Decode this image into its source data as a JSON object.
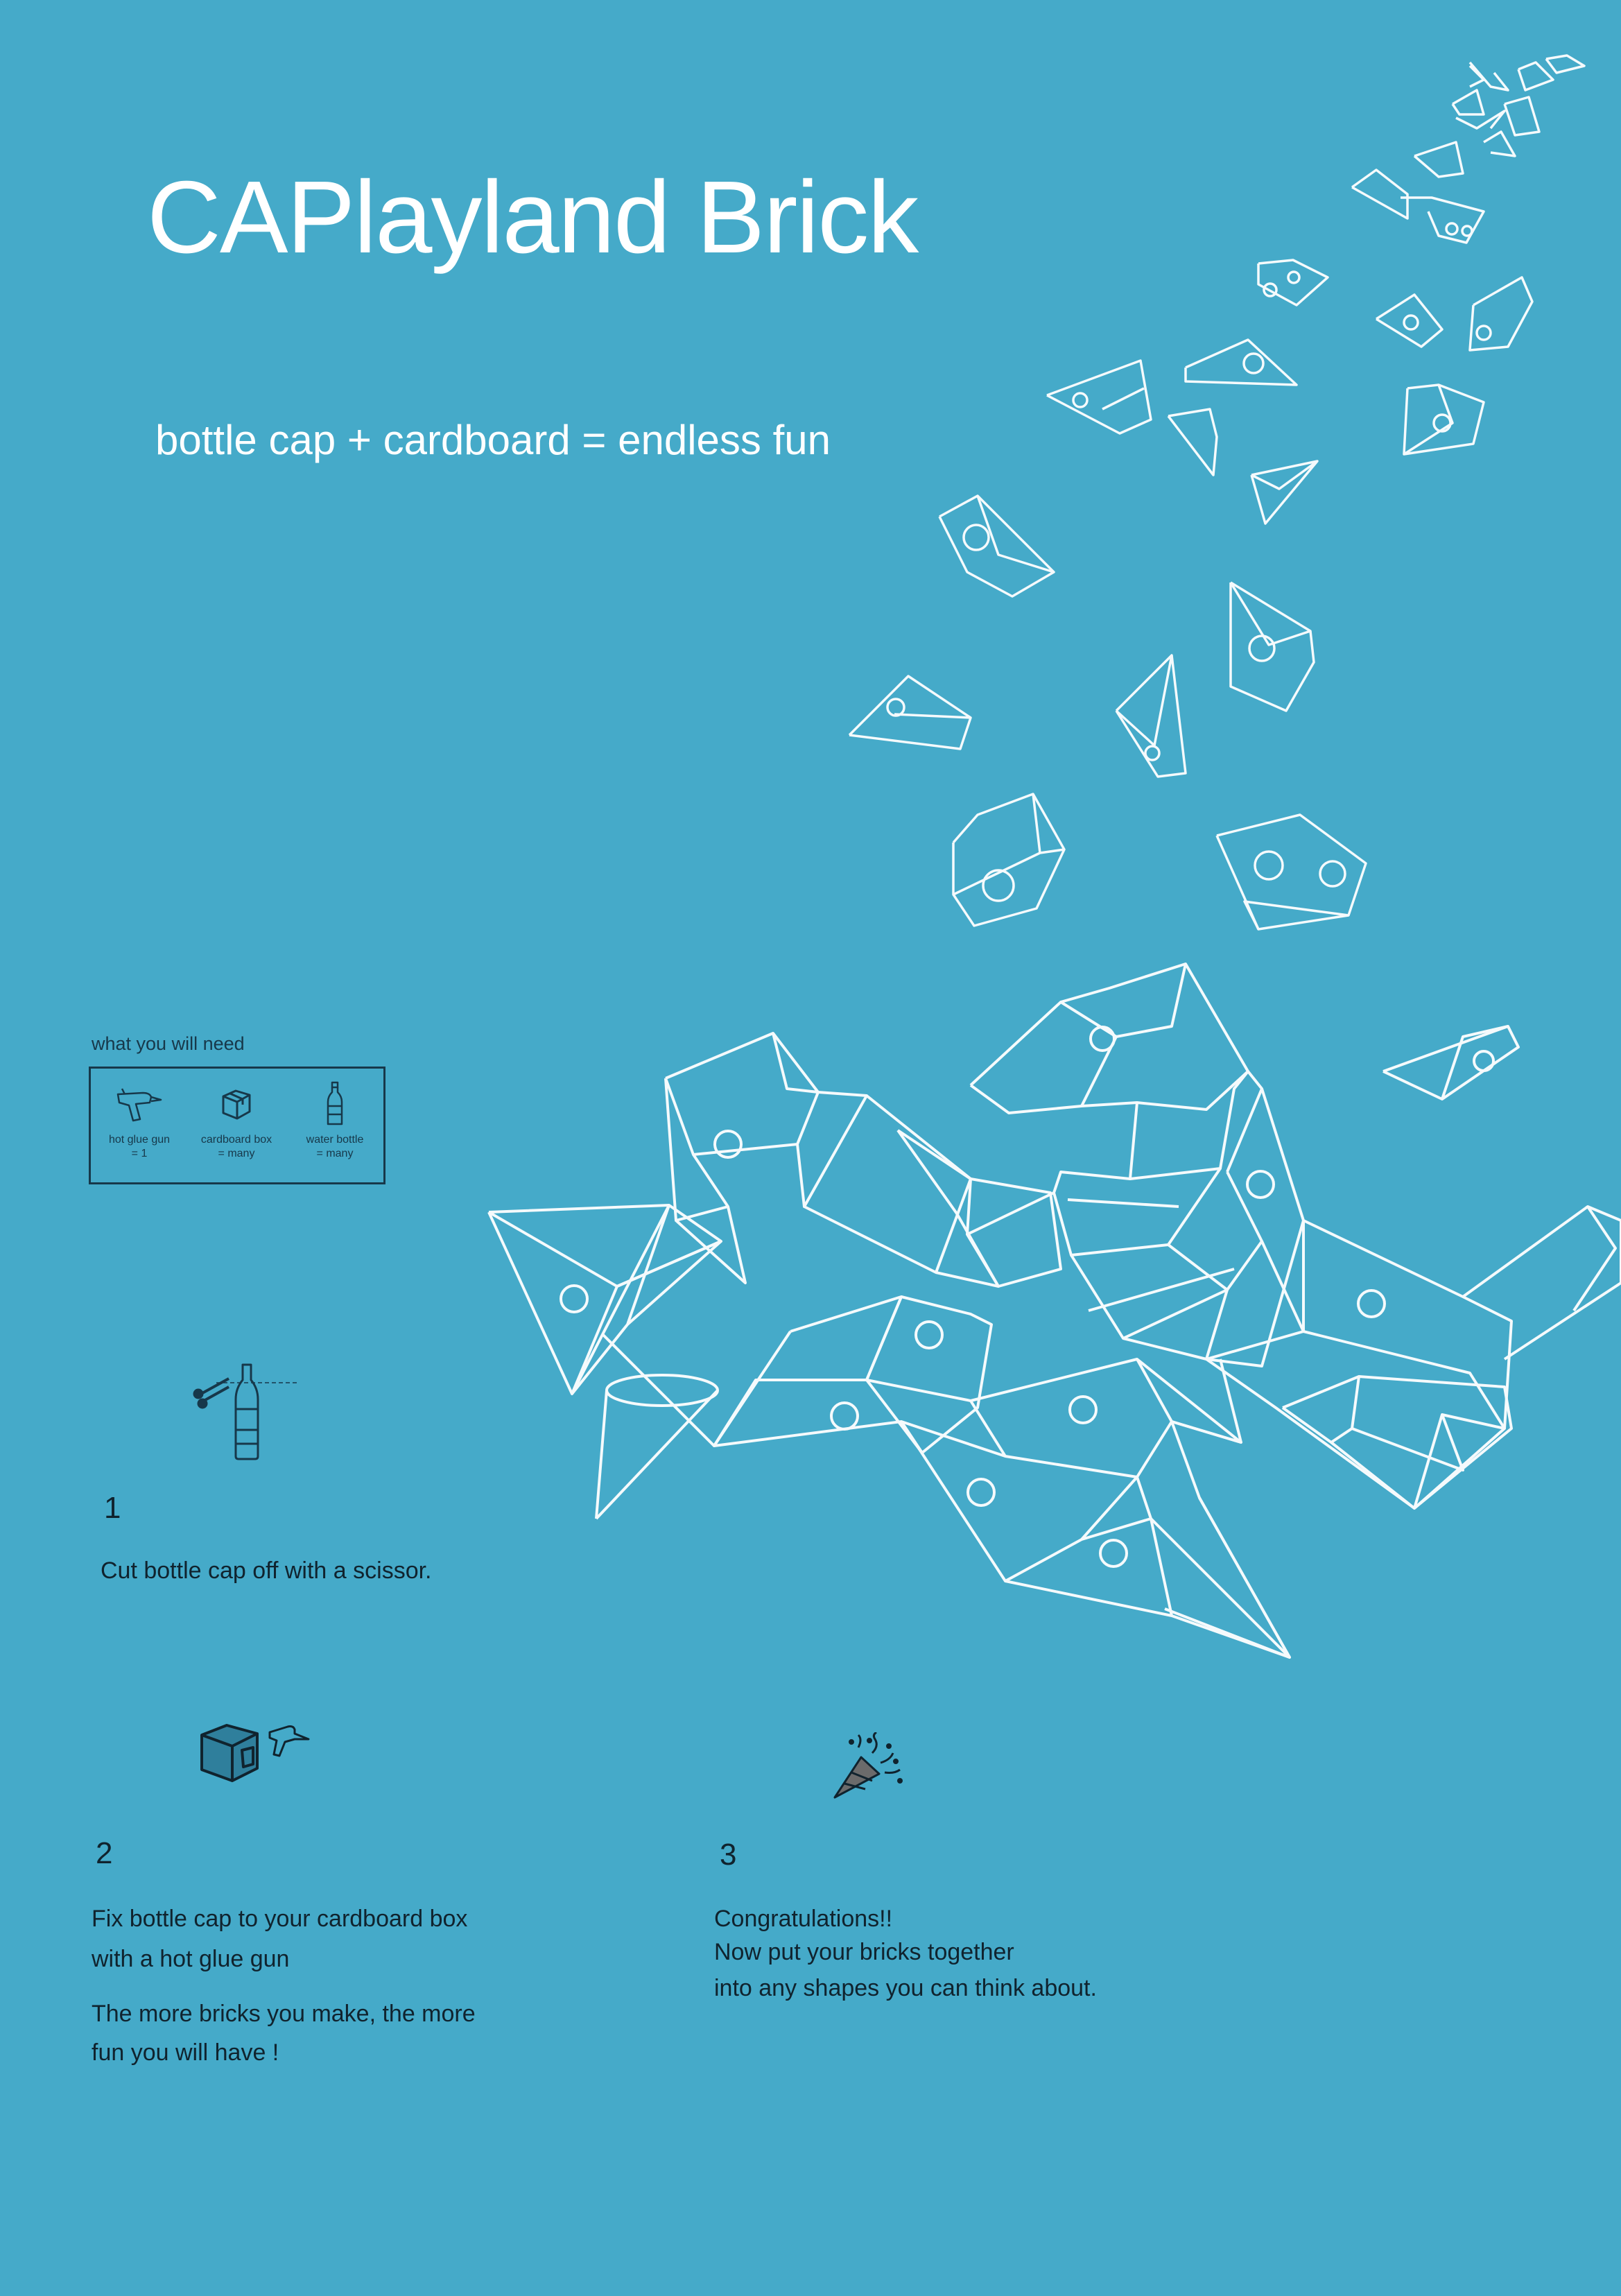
{
  "poster": {
    "title": "CAPlayland Brick",
    "subtitle": "bottle cap + cardboard = endless fun",
    "background_color": "#45aac9",
    "line_color": "#ffffff",
    "ink_color": "#17384a"
  },
  "materials": {
    "label": "what you will need",
    "items": [
      {
        "icon": "hot-glue-gun-icon",
        "name": "hot glue gun",
        "qty": "=  1"
      },
      {
        "icon": "cardboard-box-icon",
        "name": "cardboard box",
        "qty": "=  many"
      },
      {
        "icon": "water-bottle-icon",
        "name": "water bottle",
        "qty": "=  many"
      }
    ]
  },
  "steps": [
    {
      "number": "1",
      "icon": "scissors-bottle-icon",
      "lines": [
        "Cut bottle cap off with a scissor."
      ]
    },
    {
      "number": "2",
      "icon": "box-glue-gun-icon",
      "lines": [
        "Fix bottle cap to your cardboard box",
        "with a hot glue gun",
        "The more bricks you make, the more",
        "fun you will have !"
      ]
    },
    {
      "number": "3",
      "icon": "party-popper-icon",
      "lines": [
        "Congratulations!!",
        "Now put your bricks together",
        "into any shapes you can think about."
      ]
    }
  ]
}
